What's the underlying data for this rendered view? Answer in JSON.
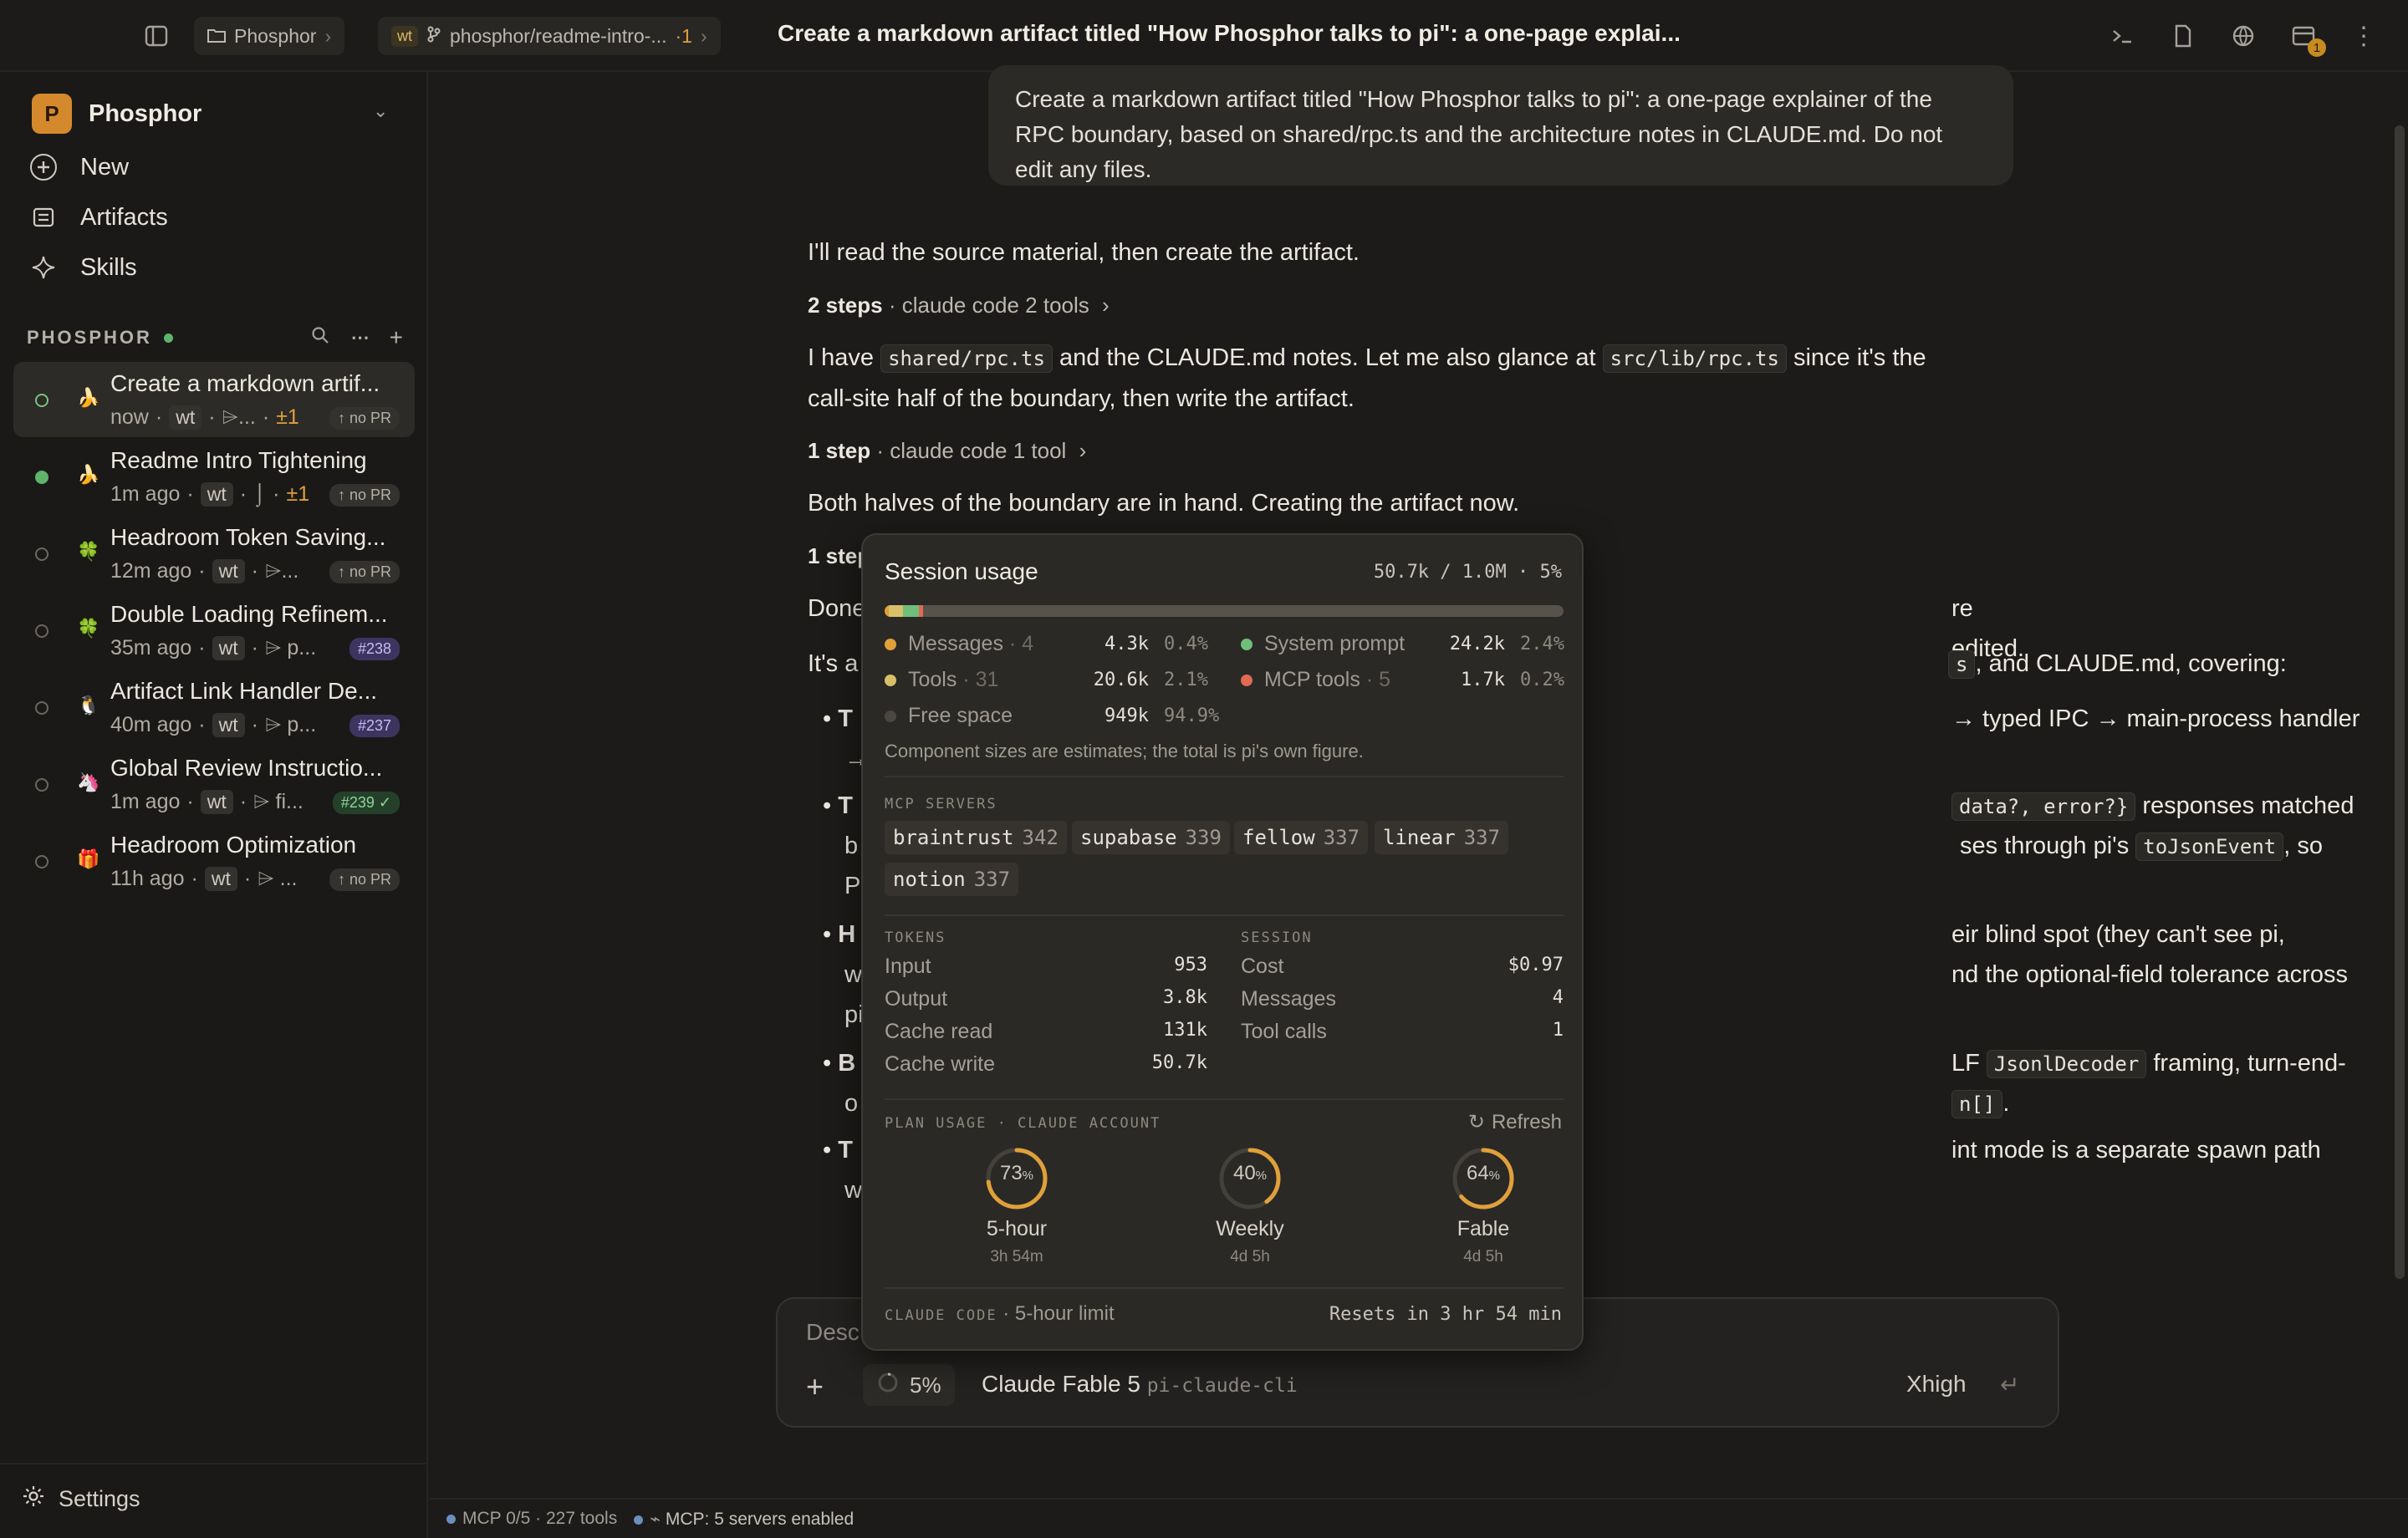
{
  "topbar": {
    "crumb_project": "Phosphor",
    "crumb_branch_badge": "wt",
    "crumb_branch": "phosphor/readme-intro-...",
    "crumb_branch_count": "·1",
    "title": "Create a markdown artifact titled \"How Phosphor talks to pi\": a one-page explai...",
    "notif_count": "1"
  },
  "sidebar": {
    "workspace_initial": "P",
    "workspace": "Phosphor",
    "nav": [
      {
        "label": "New",
        "icon": "plus-circle-icon"
      },
      {
        "label": "Artifacts",
        "icon": "artifacts-icon"
      },
      {
        "label": "Skills",
        "icon": "sparkle-icon"
      }
    ],
    "section": "PHOSPHOR",
    "sessions": [
      {
        "title": "Create a markdown artif...",
        "time": "now",
        "wt": "wt",
        "diff": "⌲...",
        "delta": "±1",
        "pr": "↑ no PR"
      },
      {
        "title": "Readme Intro Tightening",
        "time": "1m ago",
        "wt": "wt",
        "diff": "⌡",
        "delta": "±1",
        "pr": "↑ no PR"
      },
      {
        "title": "Headroom Token Saving...",
        "time": "12m ago",
        "wt": "wt",
        "diff": "⌲...",
        "delta": "",
        "pr": "↑ no PR"
      },
      {
        "title": "Double Loading Refinem...",
        "time": "35m ago",
        "wt": "wt",
        "diff": "⌲ p...",
        "delta": "",
        "pr": "#238"
      },
      {
        "title": "Artifact Link Handler De...",
        "time": "40m ago",
        "wt": "wt",
        "diff": "⌲ p...",
        "delta": "",
        "pr": "#237"
      },
      {
        "title": "Global Review Instructio...",
        "time": "1m ago",
        "wt": "wt",
        "diff": "⌲ fi...",
        "delta": "",
        "pr": "#239 ✓"
      },
      {
        "title": "Headroom Optimization",
        "time": "11h ago",
        "wt": "wt",
        "diff": "⌲ ...",
        "delta": "",
        "pr": "↑ no PR"
      }
    ],
    "settings": "Settings"
  },
  "chat": {
    "user_message": "Create a markdown artifact titled \"How Phosphor talks to pi\": a one-page explainer of the RPC boundary, based on shared/rpc.ts and the architecture notes in CLAUDE.md. Do not edit any files.",
    "p1": "I'll read the source material, then create the artifact.",
    "steps1_count": "2 steps",
    "steps1_detail": "· claude code 2 tools",
    "p2_a": "I have",
    "p2_code1": "shared/rpc.ts",
    "p2_b": "and the CLAUDE.md notes. Let me also glance at",
    "p2_code2": "src/lib/rpc.ts",
    "p2_c": "since it's the",
    "p2_d": "call-site half of the boundary, then write the artifact.",
    "steps2_count": "1 step",
    "steps2_detail": "· claude code 1 tool",
    "p3": "Both halves of the boundary are in hand. Creating the artifact now.",
    "steps3_count": "1 step",
    "p4_a": "Done",
    "p4_b": "re edited.",
    "p5_a": "It's a",
    "p5_b": ", and CLAUDE.md, covering:",
    "p5_code_tail": "s",
    "b1_head": "T",
    "b1_tail": "→ typed IPC → main-process handler",
    "b1_tail2": "→",
    "b2_head": "T",
    "b2_code": "data?, error?}",
    "b2_tail": "responses matched",
    "b2_line2a": "b",
    "b2_line2b": "ses through pi's",
    "b2_code2": "toJsonEvent",
    "b2_line2c": ", so",
    "b2_line3": "P",
    "b3_head": "H",
    "b3_tail": "eir blind spot (they can't see pi,",
    "b3_line2a": "w",
    "b3_line2b": "nd the optional-field tolerance across",
    "b3_line3": "pi",
    "b4_head": "B",
    "b4_tail_a": "LF",
    "b4_code": "JsonlDecoder",
    "b4_tail_b": "framing, turn-end-",
    "b4_line2a": "o",
    "b4_code2": "n[]",
    "b4_line2b": ".",
    "b5_head": "T",
    "b5_tail": "int mode is a separate spawn path",
    "b5_line2": "w"
  },
  "composer": {
    "placeholder": "Desc",
    "context_pct": "5%",
    "model": "Claude Fable 5",
    "provider": "pi-claude-cli",
    "effort": "Xhigh"
  },
  "statusbar": {
    "mcp_tools": "MCP 0/5 · 227 tools",
    "mcp_servers": "MCP: 5 servers enabled"
  },
  "usage": {
    "title": "Session usage",
    "summary": "50.7k / 1.0M · 5%",
    "bar_fractions": {
      "messages": 0.004,
      "tools": 0.021,
      "system": 0.024,
      "mcp": 0.002
    },
    "colors": {
      "messages": "#e0a03a",
      "tools": "#d8c06a",
      "system": "#6fbf7a",
      "mcp": "#e06a52",
      "free": "#57534c"
    },
    "rows": [
      {
        "label": "Messages",
        "count": "· 4",
        "value": "4.3k",
        "pct": "0.4%"
      },
      {
        "label": "Tools",
        "count": "· 31",
        "value": "20.6k",
        "pct": "2.1%"
      },
      {
        "label": "Free space",
        "count": "",
        "value": "949k",
        "pct": "94.9%"
      },
      {
        "label": "System prompt",
        "count": "",
        "value": "24.2k",
        "pct": "2.4%"
      },
      {
        "label": "MCP tools",
        "count": "· 5",
        "value": "1.7k",
        "pct": "0.2%"
      }
    ],
    "note": "Component sizes are estimates; the total is pi's own figure.",
    "mcp_label": "MCP SERVERS",
    "servers": [
      {
        "name": "braintrust",
        "n": "342"
      },
      {
        "name": "supabase",
        "n": "339"
      },
      {
        "name": "fellow",
        "n": "337"
      },
      {
        "name": "linear",
        "n": "337"
      },
      {
        "name": "notion",
        "n": "337"
      }
    ],
    "tokens_label": "TOKENS",
    "tokens": [
      {
        "k": "Input",
        "v": "953"
      },
      {
        "k": "Output",
        "v": "3.8k"
      },
      {
        "k": "Cache read",
        "v": "131k"
      },
      {
        "k": "Cache write",
        "v": "50.7k"
      }
    ],
    "session_label": "SESSION",
    "session": [
      {
        "k": "Cost",
        "v": "$0.97"
      },
      {
        "k": "Messages",
        "v": "4"
      },
      {
        "k": "Tool calls",
        "v": "1"
      }
    ],
    "plan_label": "PLAN USAGE · CLAUDE ACCOUNT",
    "refresh": "Refresh",
    "gauges": [
      {
        "pct": 73,
        "label": "5-hour",
        "sub": "3h 54m"
      },
      {
        "pct": 40,
        "label": "Weekly",
        "sub": "4d 5h"
      },
      {
        "pct": 64,
        "label": "Fable",
        "sub": "4d 5h"
      }
    ],
    "footer_label": "CLAUDE CODE",
    "footer_limit": "· 5-hour limit",
    "footer_reset": "Resets in 3 hr 54 min"
  }
}
